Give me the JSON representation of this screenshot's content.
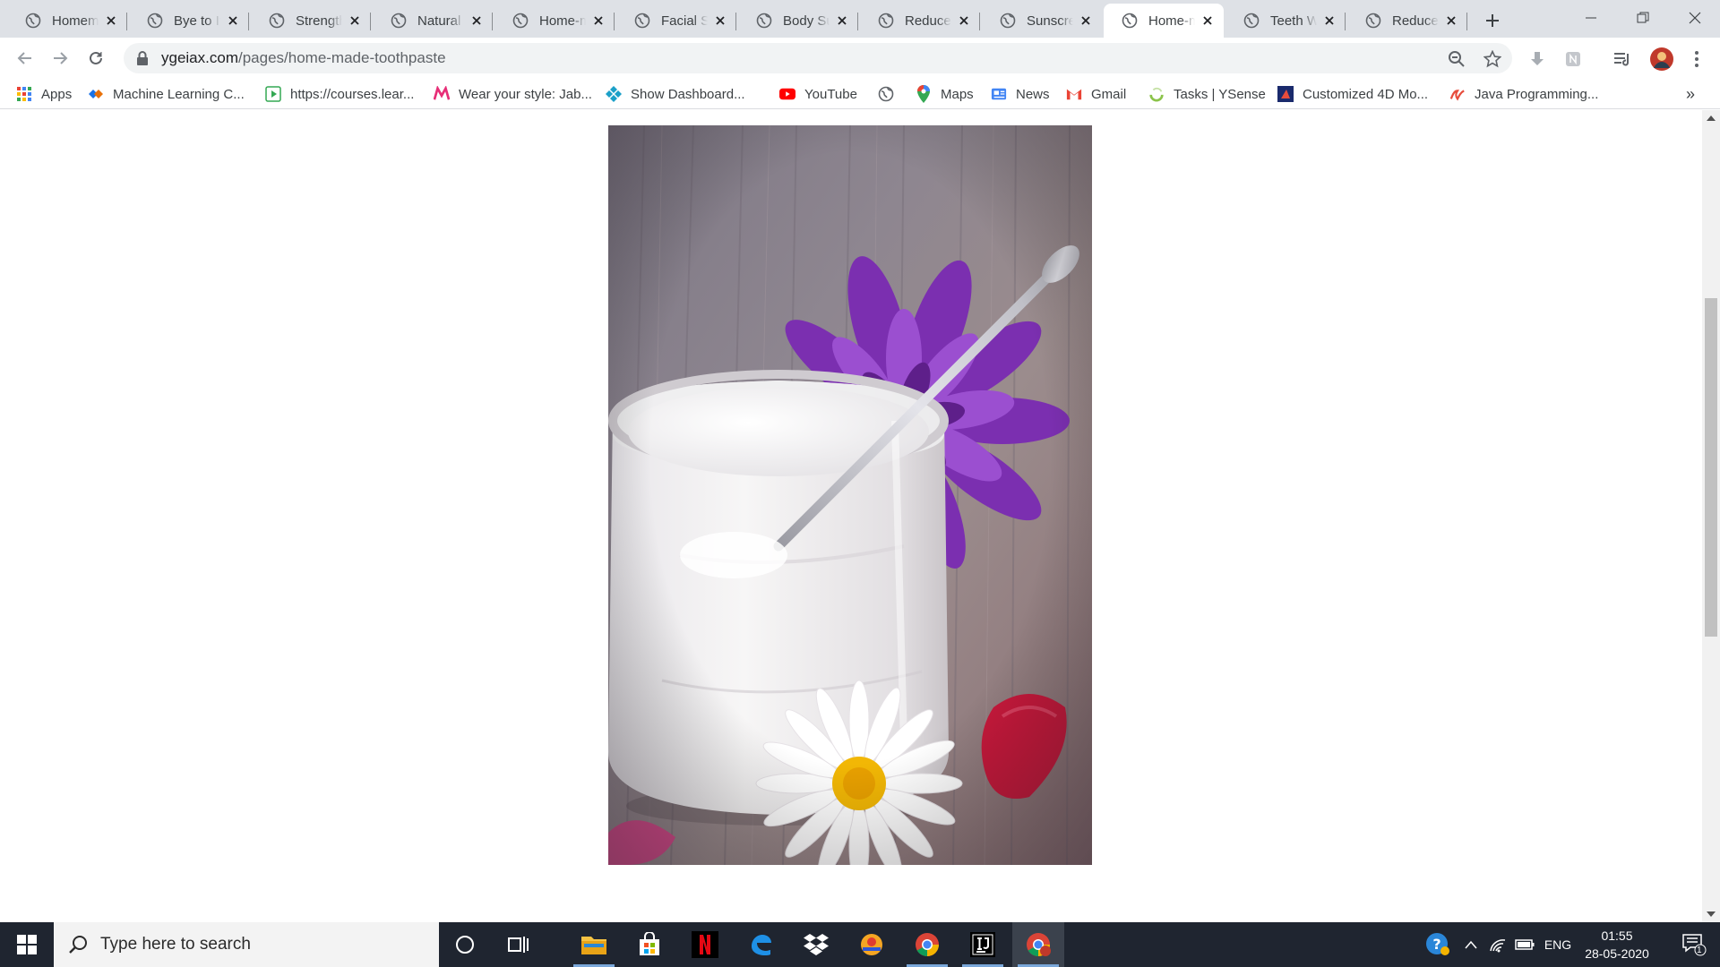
{
  "browser": {
    "tabs": [
      {
        "title": "Homemade",
        "active": false
      },
      {
        "title": "Bye to Itchy",
        "active": false
      },
      {
        "title": "Strengthen",
        "active": false
      },
      {
        "title": "Natural Face",
        "active": false
      },
      {
        "title": "Home-made",
        "active": false
      },
      {
        "title": "Facial Scrub",
        "active": false
      },
      {
        "title": "Body Sugar",
        "active": false
      },
      {
        "title": "Reduce Stress",
        "active": false
      },
      {
        "title": "Sunscreen",
        "active": false
      },
      {
        "title": "Home-made",
        "active": true
      },
      {
        "title": "Teeth Whitening",
        "active": false
      },
      {
        "title": "Reduce Weight",
        "active": false
      }
    ],
    "address": {
      "host": "ygeiax.com",
      "path": "/pages/home-made-toothpaste"
    },
    "bookmarks": [
      {
        "label": "Apps",
        "icon": "apps-grid-icon"
      },
      {
        "label": "Machine Learning C...",
        "icon": "ml-course-icon"
      },
      {
        "label": "https://courses.lear...",
        "icon": "courses-icon"
      },
      {
        "label": "Wear your style: Jab...",
        "icon": "myntra-icon"
      },
      {
        "label": "Show Dashboard...",
        "icon": "dashboard-icon"
      },
      {
        "label": "YouTube",
        "icon": "youtube-icon"
      },
      {
        "label": "",
        "icon": "globe-icon"
      },
      {
        "label": "Maps",
        "icon": "maps-icon"
      },
      {
        "label": "News",
        "icon": "news-icon"
      },
      {
        "label": "Gmail",
        "icon": "gmail-icon"
      },
      {
        "label": "Tasks | YSense",
        "icon": "ysense-icon"
      },
      {
        "label": "Customized 4D Mo...",
        "icon": "customized-icon"
      },
      {
        "label": "Java Programming...",
        "icon": "java-icon"
      }
    ],
    "bookmarks_overflow": "»"
  },
  "page": {
    "hero_image_alt": "Jar of homemade coconut oil toothpaste with spoon and flowers"
  },
  "taskbar": {
    "search_placeholder": "Type here to search",
    "apps": [
      "cortana-icon",
      "task-view-icon",
      "file-explorer-icon",
      "store-icon",
      "netflix-icon",
      "edge-icon",
      "dropbox-icon",
      "app-icon",
      "chrome-icon",
      "intellij-icon",
      "chrome-active-icon"
    ],
    "language": "ENG",
    "time": "01:55",
    "date": "28-05-2020",
    "notification_count": "1"
  },
  "colors": {
    "tabstrip": "#dee1e6",
    "taskbar": "#1f2530",
    "accent": "#1a73e8"
  }
}
